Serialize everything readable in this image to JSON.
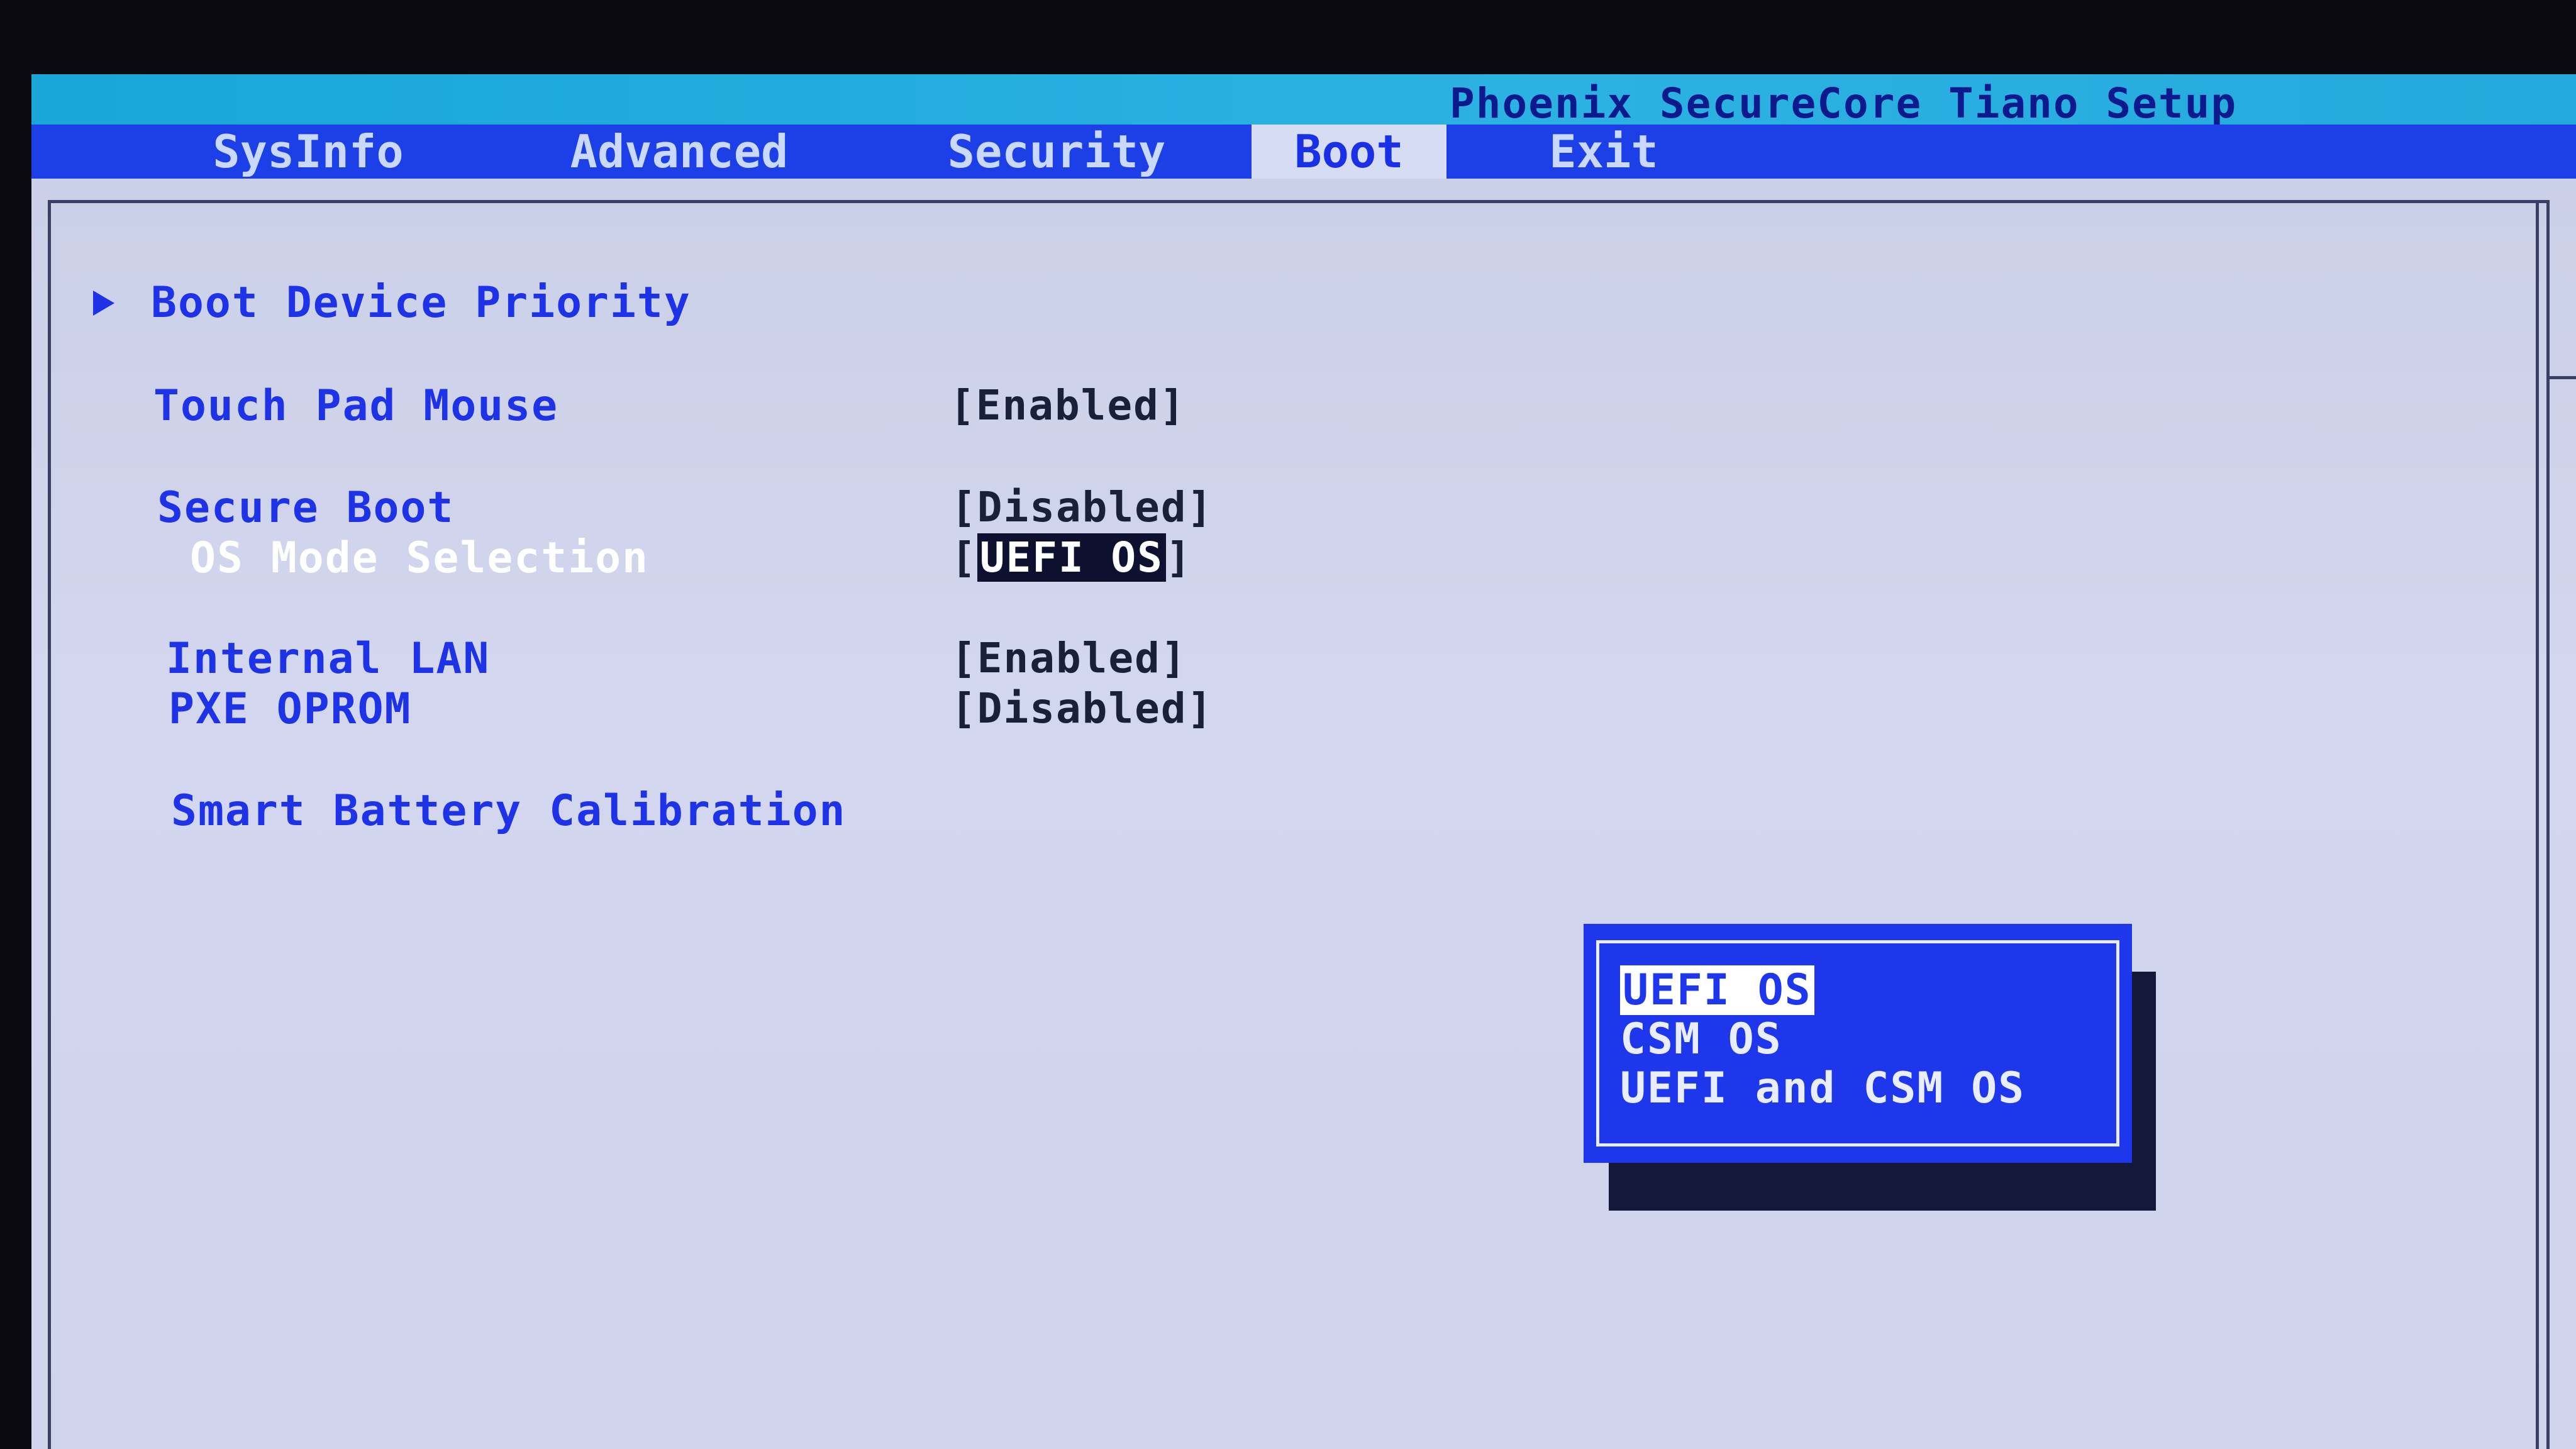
{
  "app_title": "Phoenix SecureCore Tiano Setup",
  "menu": {
    "tabs": [
      {
        "label": "SysInfo"
      },
      {
        "label": "Advanced"
      },
      {
        "label": "Security"
      },
      {
        "label": "Boot"
      },
      {
        "label": "Exit"
      }
    ],
    "active_tab": "Boot"
  },
  "boot_menu": {
    "boot_device_priority": "Boot Device Priority",
    "touch_pad_mouse": {
      "label": "Touch Pad Mouse",
      "value": "[Enabled]"
    },
    "secure_boot": {
      "label": "Secure Boot",
      "value": "[Disabled]"
    },
    "os_mode_selection": {
      "label": "OS Mode Selection",
      "bracket_open": "[",
      "value": "UEFI OS",
      "bracket_close": "]"
    },
    "internal_lan": {
      "label": "Internal LAN",
      "value": "[Enabled]"
    },
    "pxe_oprom": {
      "label": "PXE OPROM",
      "value": "[Disabled]"
    },
    "smart_battery_calibration": "Smart Battery Calibration"
  },
  "os_mode_popup": {
    "options": [
      "UEFI OS",
      "CSM OS",
      "UEFI and CSM OS"
    ],
    "selected": "UEFI OS"
  },
  "colors": {
    "title_bar": "#19a6d8",
    "menu_bar": "#1d3fe8",
    "item_text": "#1e33e8",
    "background": "#cfd3ec",
    "popup": "#1e37ec"
  }
}
